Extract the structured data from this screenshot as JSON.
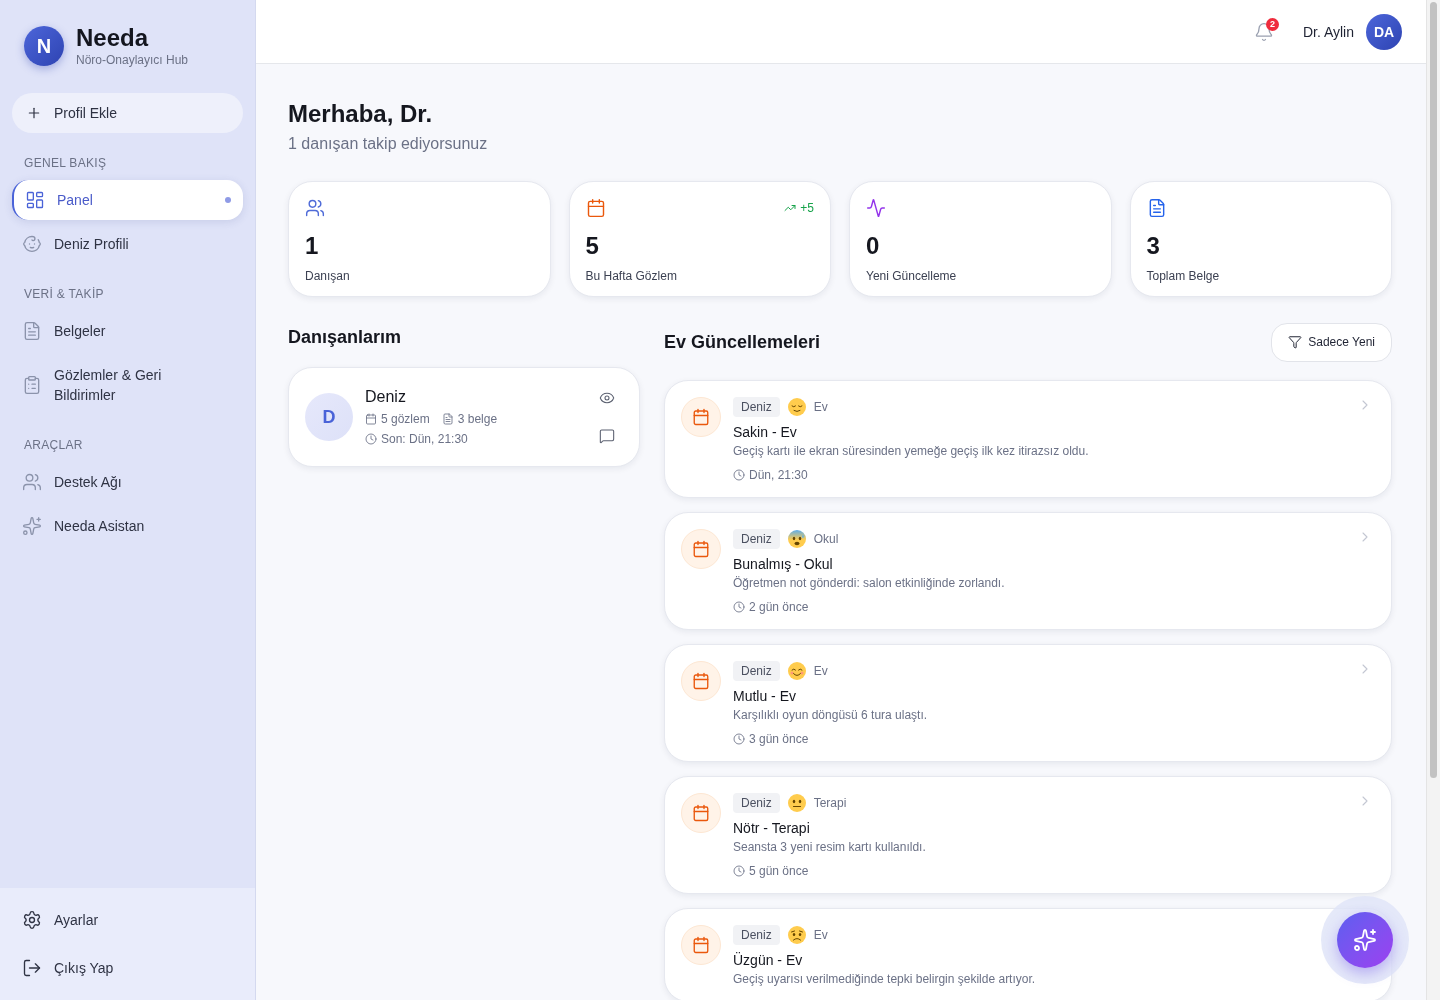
{
  "sidebar": {
    "logo_letter": "N",
    "brand": "Needa",
    "tagline": "Nöro-Onaylayıcı Hub",
    "add_button": "Profil Ekle",
    "sections": [
      {
        "title": "GENEL BAKIŞ",
        "items": [
          {
            "label": "Panel",
            "selected": true
          },
          {
            "label": "Deniz Profili",
            "selected": false
          }
        ]
      },
      {
        "title": "VERİ & TAKİP",
        "items": [
          {
            "label": "Belgeler",
            "selected": false
          },
          {
            "label": "Gözlemler & Geri Bildirimler",
            "selected": false
          }
        ]
      },
      {
        "title": "ARAÇLAR",
        "items": [
          {
            "label": "Destek Ağı",
            "selected": false
          },
          {
            "label": "Needa Asistan",
            "selected": false
          }
        ]
      }
    ],
    "footer_items": [
      {
        "label": "Ayarlar"
      },
      {
        "label": "Çıkış Yap"
      }
    ]
  },
  "header": {
    "notification_count": "2",
    "user_name": "Dr. Aylin",
    "avatar_initials": "DA"
  },
  "greeting": {
    "title": "Merhaba, Dr.",
    "subtitle": "1 danışan takip ediyorsunuz"
  },
  "stats": [
    {
      "value": "1",
      "label": "Danışan",
      "color": "#4f6bd8"
    },
    {
      "value": "5",
      "label": "Bu Hafta Gözlem",
      "color": "#ea580c",
      "trend": "+5"
    },
    {
      "value": "0",
      "label": "Yeni Güncelleme",
      "color": "#9333ea"
    },
    {
      "value": "3",
      "label": "Toplam Belge",
      "color": "#2563eb"
    }
  ],
  "clients": {
    "title": "Danışanlarım",
    "items": [
      {
        "initial": "D",
        "name": "Deniz",
        "observations": "5 gözlem",
        "documents": "3 belge",
        "last_seen": "Son: Dün, 21:30"
      }
    ]
  },
  "updates": {
    "title": "Ev Güncellemeleri",
    "filter_button": "Sadece Yeni",
    "items": [
      {
        "tag": "Deniz",
        "mood": {
          "kind": "calm"
        },
        "context": "Ev",
        "title": "Sakin - Ev",
        "description": "Geçiş kartı ile ekran süresinden yemeğe geçiş ilk kez itirazsız oldu.",
        "time": "Dün, 21:30"
      },
      {
        "tag": "Deniz",
        "mood": {
          "kind": "anxious"
        },
        "context": "Okul",
        "title": "Bunalmış - Okul",
        "description": "Öğretmen not gönderdi: salon etkinliğinde zorlandı.",
        "time": "2 gün önce"
      },
      {
        "tag": "Deniz",
        "mood": {
          "kind": "happy"
        },
        "context": "Ev",
        "title": "Mutlu - Ev",
        "description": "Karşılıklı oyun döngüsü 6 tura ulaştı.",
        "time": "3 gün önce"
      },
      {
        "tag": "Deniz",
        "mood": {
          "kind": "neutral"
        },
        "context": "Terapi",
        "title": "Nötr - Terapi",
        "description": "Seansta 3 yeni resim kartı kullanıldı.",
        "time": "5 gün önce"
      },
      {
        "tag": "Deniz",
        "mood": {
          "kind": "sad"
        },
        "context": "Ev",
        "title": "Üzgün - Ev",
        "description": "Geçiş uyarısı verilmediğinde tepki belirgin şekilde artıyor."
      }
    ]
  }
}
